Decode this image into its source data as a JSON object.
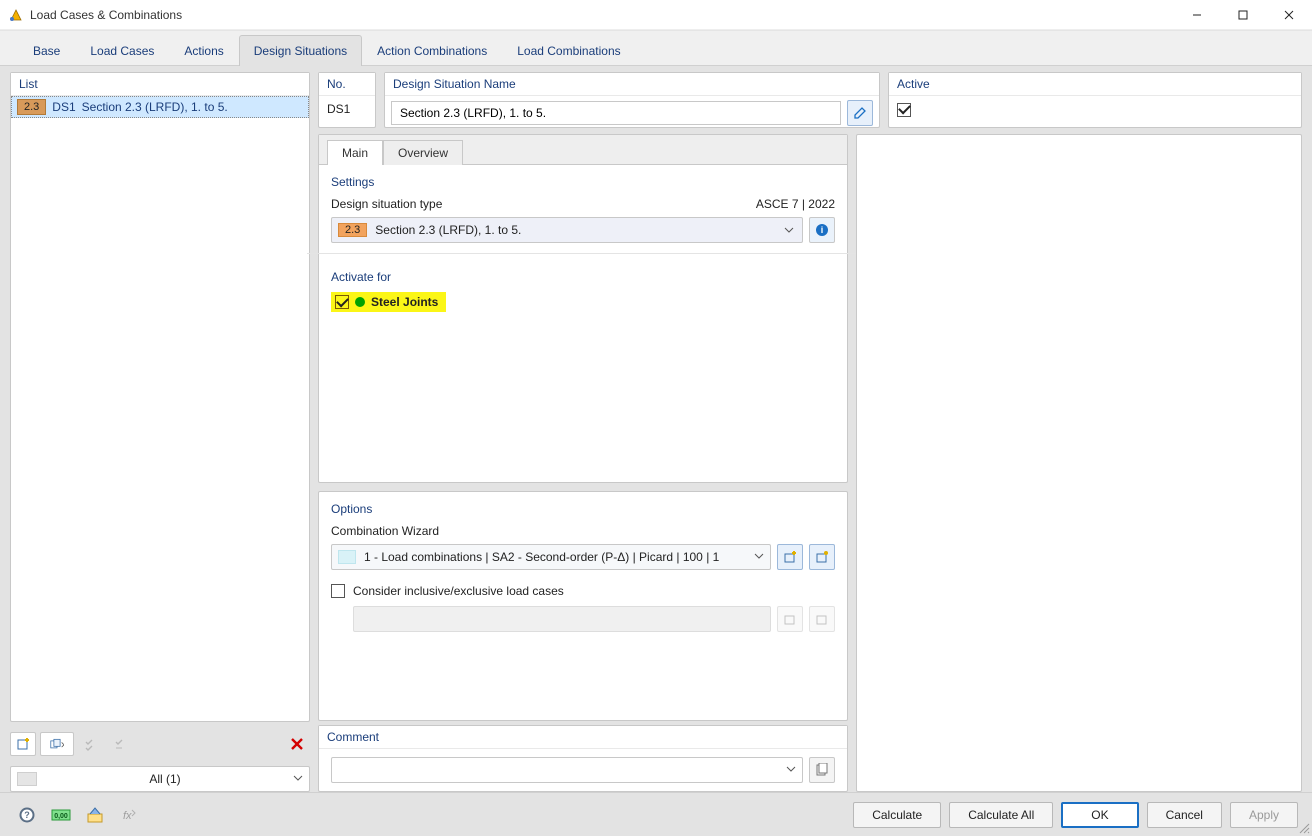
{
  "window": {
    "title": "Load Cases & Combinations"
  },
  "tabs": {
    "items": [
      "Base",
      "Load Cases",
      "Actions",
      "Design Situations",
      "Action Combinations",
      "Load Combinations"
    ],
    "activeIndex": 3
  },
  "list": {
    "header": "List",
    "rows": [
      {
        "chip": "2.3",
        "id": "DS1",
        "name": "Section 2.3 (LRFD), 1. to 5."
      }
    ],
    "filter": "All (1)"
  },
  "no": {
    "header": "No.",
    "value": "DS1"
  },
  "name": {
    "header": "Design Situation Name",
    "value": "Section 2.3 (LRFD), 1. to 5."
  },
  "active": {
    "header": "Active",
    "checked": true
  },
  "subtabs": {
    "items": [
      "Main",
      "Overview"
    ],
    "activeIndex": 0
  },
  "settings": {
    "title": "Settings",
    "dst_label": "Design situation type",
    "code": "ASCE 7 | 2022",
    "combo_chip": "2.3",
    "combo_text": "Section 2.3 (LRFD), 1. to 5."
  },
  "activate": {
    "title": "Activate for",
    "item": "Steel Joints",
    "checked": true
  },
  "options": {
    "title": "Options",
    "wizard_label": "Combination Wizard",
    "wizard_value": "1 - Load combinations | SA2 - Second-order (P-Δ) | Picard | 100 | 1",
    "consider_label": "Consider inclusive/exclusive load cases",
    "consider_checked": false
  },
  "comment": {
    "title": "Comment",
    "value": ""
  },
  "footer": {
    "calculate": "Calculate",
    "calculate_all": "Calculate All",
    "ok": "OK",
    "cancel": "Cancel",
    "apply": "Apply"
  }
}
